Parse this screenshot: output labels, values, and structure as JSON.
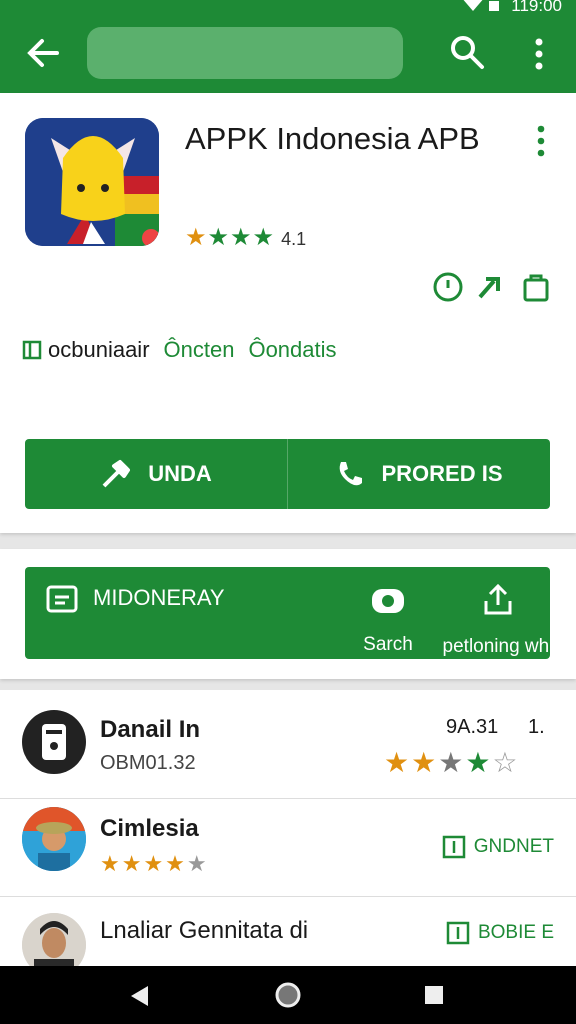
{
  "status_bar": {
    "time": "119:00"
  },
  "app": {
    "title": "APPK Indonesia APB",
    "rating_text": "★★★★",
    "rating_value": "4.1",
    "tags": [
      "ocbuniaair",
      "Ôncten",
      "Ôondatis"
    ],
    "buttons": {
      "left": "UNDA",
      "right": "PRORED IS"
    }
  },
  "banner": {
    "label": "MIDONERAY",
    "action1": "Sarch",
    "action2": "petloning whi"
  },
  "list": [
    {
      "name": "Danail In",
      "subtitle": "OBM01.32",
      "version": "9A.31",
      "counter": "1."
    },
    {
      "name": "Cimlesia",
      "button": "GNDNET"
    },
    {
      "name": "Lnaliar Gennitata di",
      "button": "BOBIE E"
    }
  ],
  "colors": {
    "primary": "#1e8a36",
    "star_orange": "#e09010"
  }
}
